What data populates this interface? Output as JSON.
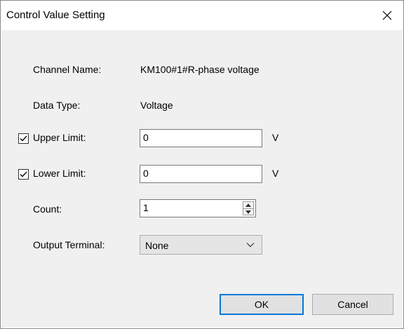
{
  "window": {
    "title": "Control Value Setting"
  },
  "fields": {
    "channel_name_label": "Channel Name:",
    "channel_name_value": "KM100#1#R-phase voltage",
    "data_type_label": "Data Type:",
    "data_type_value": "Voltage",
    "upper_limit_label": "Upper Limit:",
    "upper_limit_checked": true,
    "upper_limit_value": "0",
    "upper_limit_unit": "V",
    "lower_limit_label": "Lower Limit:",
    "lower_limit_checked": true,
    "lower_limit_value": "0",
    "lower_limit_unit": "V",
    "count_label": "Count:",
    "count_value": "1",
    "output_terminal_label": "Output Terminal:",
    "output_terminal_selected": "None"
  },
  "buttons": {
    "ok": "OK",
    "cancel": "Cancel"
  },
  "icons": {
    "close": "close-icon",
    "check": "checkmark-icon",
    "spin_up": "spin-up-icon",
    "spin_down": "spin-down-icon",
    "dropdown": "chevron-down-icon"
  },
  "colors": {
    "dialog_background": "#f0f0f0",
    "titlebar_background": "#ffffff",
    "default_button_border": "#0078d7"
  }
}
